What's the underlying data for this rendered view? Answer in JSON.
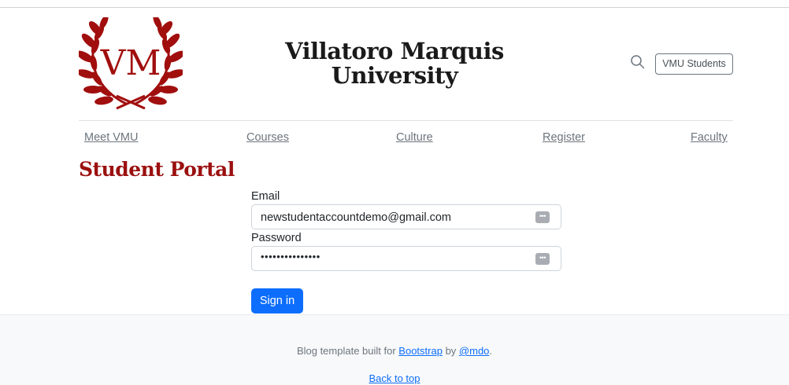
{
  "header": {
    "logo_text": "VM",
    "title_line1": "Villatoro Marquis",
    "title_line2": "University",
    "students_button": "VMU Students",
    "search_icon": "search-icon"
  },
  "nav": {
    "items": [
      "Meet VMU",
      "Courses",
      "Culture",
      "Register",
      "Faculty"
    ]
  },
  "main": {
    "title": "Student Portal",
    "email_label": "Email",
    "email_value": "newstudentaccountdemo@gmail.com",
    "password_label": "Password",
    "password_value": "•••••••••••••••",
    "key_icon_glyph": "•••",
    "signin_label": "Sign in"
  },
  "footer": {
    "text_prefix": "Blog template built for ",
    "link_bootstrap": "Bootstrap",
    "text_mid": " by ",
    "link_mdo": "@mdo",
    "text_suffix": ".",
    "back_to_top": "Back to top"
  },
  "colors": {
    "brand_red": "#9b1010",
    "primary_blue": "#0d6efd",
    "footer_bg": "#f8f9fa"
  }
}
